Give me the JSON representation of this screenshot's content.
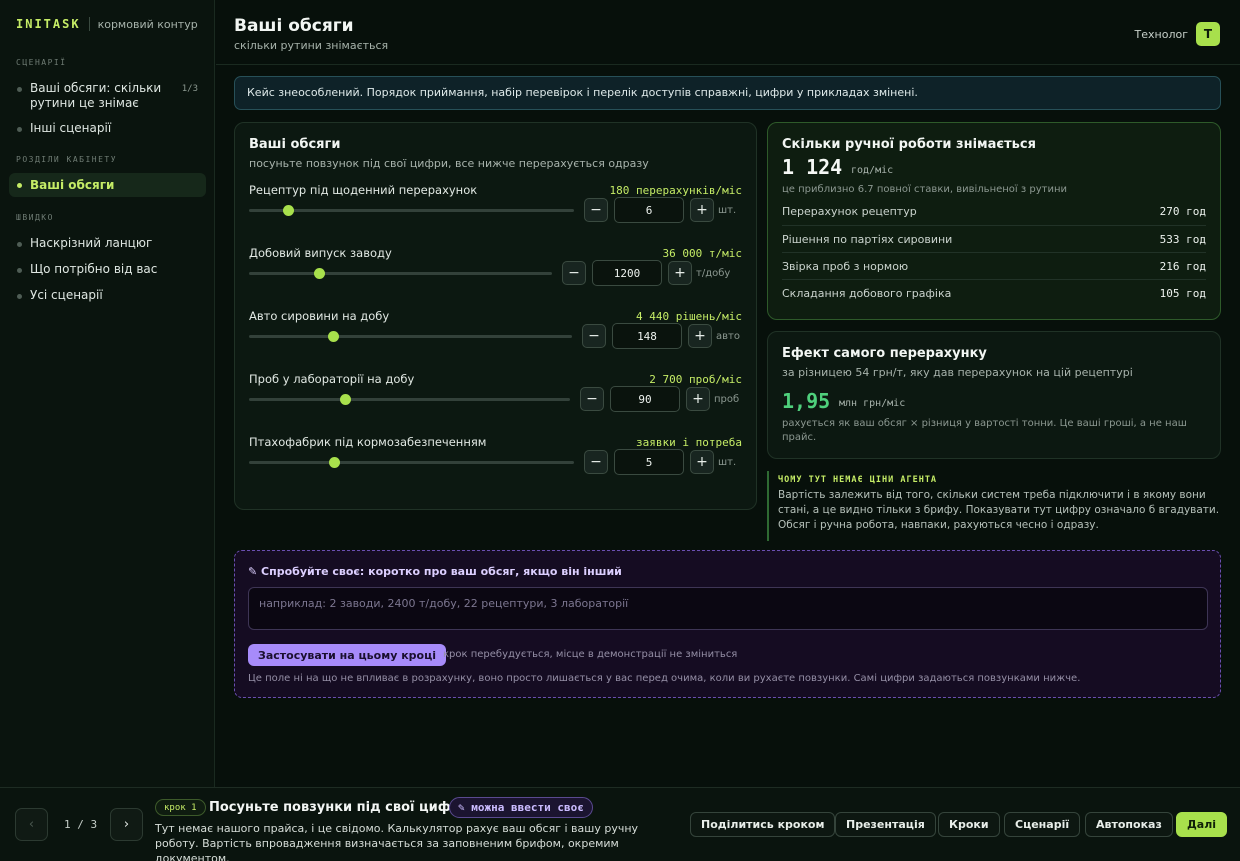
{
  "brand": {
    "logo": "INITASK",
    "subtitle": "кормовий контур"
  },
  "sidebar": {
    "sections": [
      {
        "title": "СЦЕНАРІЇ"
      },
      {
        "title": "РОЗДІЛИ КАБІНЕТУ"
      },
      {
        "title": "ШВИДКО"
      }
    ],
    "scenarios": [
      {
        "label": "Ваші обсяги: скільки рутини це знімає",
        "count": "1/3"
      },
      {
        "label": "Інші сценарії"
      }
    ],
    "sections_items": [
      {
        "label": "Ваші обсяги",
        "active": true
      }
    ],
    "quick": [
      {
        "label": "Наскрізний ланцюг"
      },
      {
        "label": "Що потрібно від вас"
      },
      {
        "label": "Усі сценарії"
      }
    ]
  },
  "header": {
    "title": "Ваші обсяги",
    "subtitle": "скільки рутини знімається",
    "role": "Технолог",
    "avatar": "Т"
  },
  "notice": "Кейс знеособлений. Порядок приймання, набір перевірок і перелік доступів справжні, цифри у прикладах змінені.",
  "sliders_card": {
    "title": "Ваші обсяги",
    "subtitle": "посуньте повзунок під свої цифри, все нижче перерахується одразу",
    "items": [
      {
        "label": "Рецептур під щоденний перерахунок",
        "result": "180 перерахунків/міс",
        "value": "6",
        "unit": "шт.",
        "level": 0.12
      },
      {
        "label": "Добовий випуск заводу",
        "result": "36 000 т/міс",
        "value": "1200",
        "unit": "т/добу",
        "level": 0.23
      },
      {
        "label": "Авто сировини на добу",
        "result": "4 440 рішень/міс",
        "value": "148",
        "unit": "авто",
        "level": 0.26
      },
      {
        "label": "Проб у лабораторії на добу",
        "result": "2 700 проб/міс",
        "value": "90",
        "unit": "проб",
        "level": 0.3
      },
      {
        "label": "Птахофабрик під кормозабезпеченням",
        "result": "заявки і потреба",
        "value": "5",
        "unit": "шт.",
        "level": 0.26
      }
    ],
    "minus": "−",
    "plus": "+"
  },
  "hours_card": {
    "title": "Скільки ручної роботи знімається",
    "value": "1 124",
    "unit": "год/міс",
    "note": "це приблизно 6.7 повної ставки, вивільненої з рутини",
    "rows": [
      {
        "label": "Перерахунок рецептур",
        "value": "270 год"
      },
      {
        "label": "Рішення по партіях сировини",
        "value": "533 год"
      },
      {
        "label": "Звірка проб з нормою",
        "value": "216 год"
      },
      {
        "label": "Складання добового графіка",
        "value": "105 год"
      }
    ]
  },
  "effect_card": {
    "title": "Ефект самого перерахунку",
    "subtitle": "за різницею 54 грн/т, яку дав перерахунок на цій рецептурі",
    "value": "1,95",
    "unit": "млн грн/міс",
    "note": "рахується як ваш обсяг × різниця у вартості тонни. Це ваші гроші, а не наш прайс."
  },
  "why": {
    "title": "ЧОМУ ТУТ НЕМАЄ ЦІНИ АГЕНТА",
    "text": "Вартість залежить від того, скільки систем треба підключити і в якому вони стані, а це видно тільки з брифу. Показувати тут цифру означало б вгадувати. Обсяг і ручна робота, навпаки, рахуються чесно і одразу."
  },
  "try_own": {
    "title": "✎ Спробуйте своє: коротко про ваш обсяг, якщо він інший",
    "placeholder": "наприклад: 2 заводи, 2400 т/добу, 22 рецептури, 3 лабораторії",
    "button": "Застосувати на цьому кроці",
    "hint": "крок перебудується, місце в демонстрації не зміниться",
    "note": "Це поле ні на що не впливає в розрахунку, воно просто лишається у вас перед очима, коли ви рухаєте повзунки. Самі цифри задаються повзунками нижче."
  },
  "footer": {
    "prev": "‹",
    "next": "›",
    "pager": "1 / 3",
    "step_badge": "крок 1",
    "step_title": "Посуньте повзунки під свої цифри",
    "own_chip": "✎ можна ввести своє",
    "step_desc": "Тут немає нашого прайса, і це свідомо. Калькулятор рахує ваш обсяг і вашу ручну роботу. Вартість впровадження визначається за заповненим брифом, окремим документом.",
    "buttons": {
      "share": "Поділитись кроком",
      "presentation": "Презентація",
      "steps": "Кроки",
      "scenarios": "Сценарії",
      "autoplay": "Автопоказ",
      "next": "Далі"
    }
  }
}
